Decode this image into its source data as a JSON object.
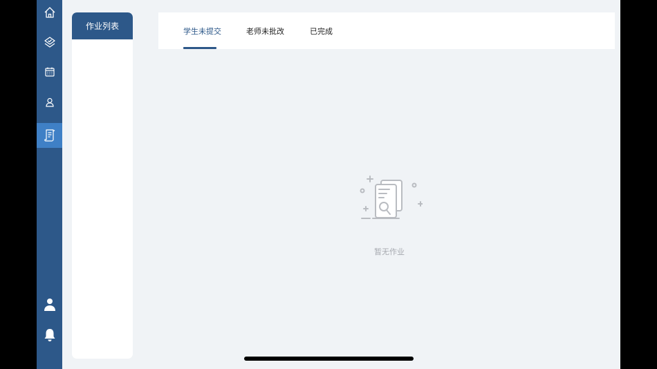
{
  "sidebar": {
    "items": [
      {
        "name": "home",
        "icon": "home-icon",
        "active": false
      },
      {
        "name": "courses",
        "icon": "layers-icon",
        "active": false
      },
      {
        "name": "schedule",
        "icon": "calendar-icon",
        "active": false
      },
      {
        "name": "profile",
        "icon": "user-icon",
        "active": false
      },
      {
        "name": "homework",
        "icon": "document-icon",
        "active": true
      }
    ],
    "bottom_items": [
      {
        "name": "account",
        "icon": "person-filled-icon"
      },
      {
        "name": "notifications",
        "icon": "bell-icon"
      }
    ]
  },
  "list_panel": {
    "title": "作业列表"
  },
  "tabs": [
    {
      "label": "学生未提交",
      "active": true
    },
    {
      "label": "老师未批改",
      "active": false
    },
    {
      "label": "已完成",
      "active": false
    }
  ],
  "empty_state": {
    "icon": "empty-homework-icon",
    "message": "暂无作业"
  },
  "colors": {
    "sidebar": "#2d5889",
    "active_nav": "#3f80c6",
    "background": "#f0f3f6",
    "accent": "#2d5889",
    "empty_text": "#a7aab0"
  }
}
